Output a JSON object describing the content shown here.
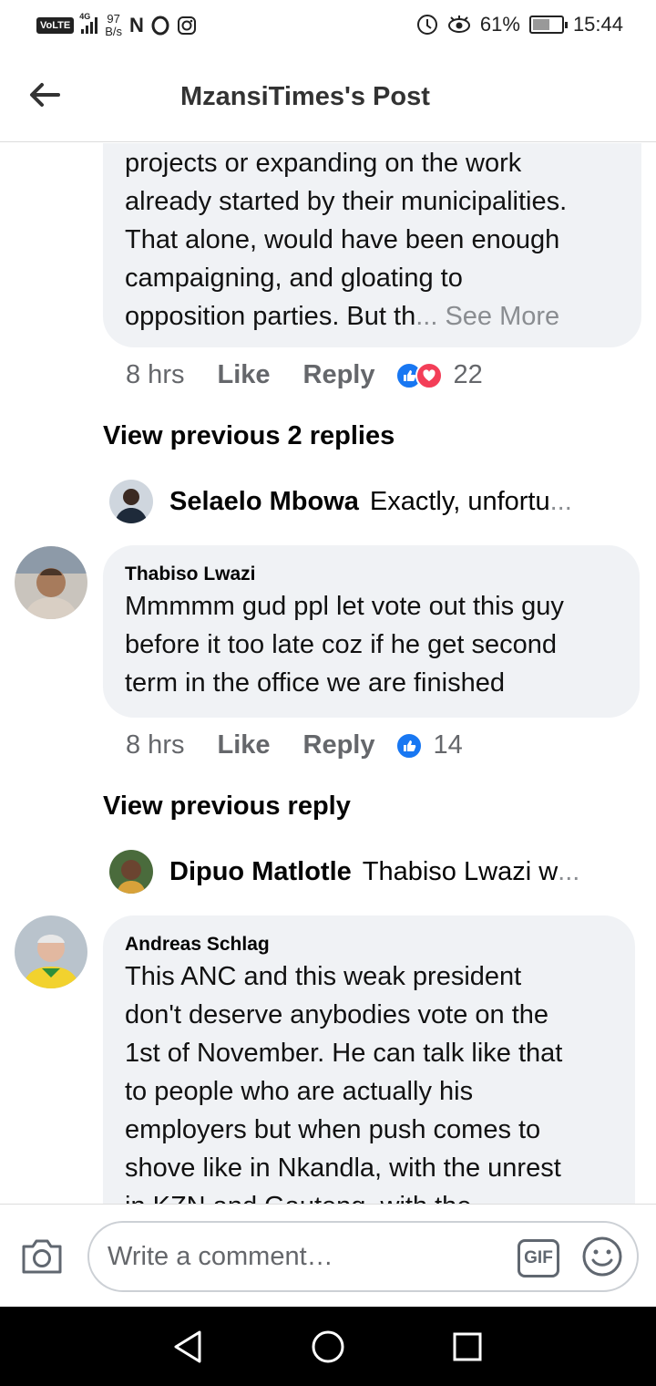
{
  "status_bar": {
    "network": "4G",
    "volte": "VoLTE",
    "speed_value": "97",
    "speed_unit": "B/s",
    "battery": "61%",
    "battery_level": 0.61,
    "time": "15:44"
  },
  "header": {
    "title": "MzansiTimes's Post"
  },
  "comments": {
    "c1": {
      "text_lines": [
        "projects or expanding on the work",
        "already started by their municipalities.",
        "That alone, would have been enough",
        "campaigning, and gloating to"
      ],
      "last_line": "opposition parties. But th",
      "ellipsis": "... ",
      "see_more": "See More",
      "time": "8 hrs",
      "like": "Like",
      "reply": "Reply",
      "reactions": [
        "like",
        "love"
      ],
      "reaction_count": "22"
    },
    "view_prev_1": "View previous 2 replies",
    "reply_1": {
      "name": "Selaelo Mbowa",
      "text": "Exactly, unfortu",
      "ellipsis": "..."
    },
    "c2": {
      "author": "Thabiso Lwazi",
      "text_lines": [
        "Mmmmm gud ppl let vote out this guy",
        "before it too late coz if he get second",
        "term in the office we are finished"
      ],
      "time": "8 hrs",
      "like": "Like",
      "reply": "Reply",
      "reactions": [
        "like"
      ],
      "reaction_count": "14"
    },
    "view_prev_2": "View previous reply",
    "reply_2": {
      "name": "Dipuo Matlotle",
      "text": "Thabiso Lwazi w",
      "ellipsis": "..."
    },
    "c3": {
      "author": "Andreas Schlag",
      "text_lines": [
        "This ANC and this weak president",
        "don't deserve anybodies vote on the",
        "1st of November. He can talk like that",
        "to people who are actually his",
        "employers but when push comes to",
        "shove like in Nkandla, with the unrest",
        "in KZN and Gauteng, with the"
      ]
    }
  },
  "composer": {
    "placeholder": "Write a comment…",
    "gif_label": "GIF"
  },
  "colors": {
    "like_blue": "#1877f2",
    "love_red": "#f33e58",
    "bubble_bg": "#f0f2f5",
    "muted": "#65676b"
  }
}
